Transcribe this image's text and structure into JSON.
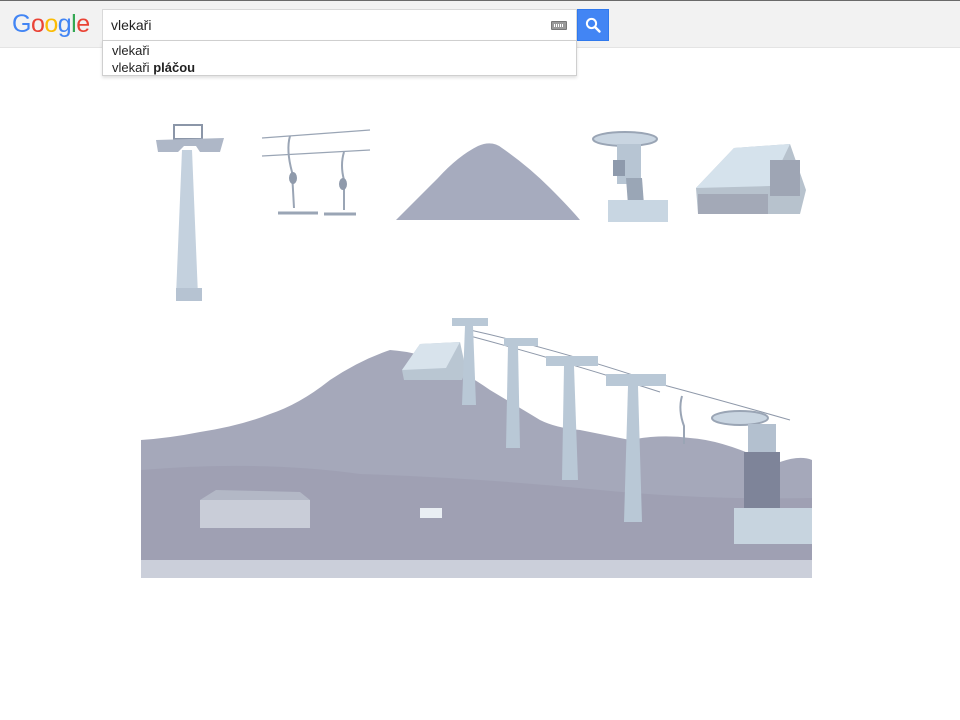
{
  "header": {
    "logo_letters": [
      {
        "char": "G",
        "color": "#4285f4"
      },
      {
        "char": "o",
        "color": "#ea4335"
      },
      {
        "char": "o",
        "color": "#fbbc05"
      },
      {
        "char": "g",
        "color": "#4285f4"
      },
      {
        "char": "l",
        "color": "#34a853"
      },
      {
        "char": "e",
        "color": "#ea4335"
      }
    ]
  },
  "search": {
    "value": "vlekaři",
    "keyboard_icon": "keyboard-icon",
    "button_icon": "search-icon"
  },
  "suggestions": [
    {
      "prefix": "vlekaři",
      "completion": ""
    },
    {
      "prefix": "vlekaři",
      "completion": "pláčou"
    }
  ],
  "colors": {
    "accent": "#4285f4",
    "illustration_fill": "#a3a9bd",
    "illustration_light": "#c7d3de"
  },
  "illustrations": {
    "icons": [
      "lift-tower-icon",
      "t-bar-lift-icon",
      "hill-icon",
      "lift-station-icon",
      "hut-icon"
    ]
  }
}
